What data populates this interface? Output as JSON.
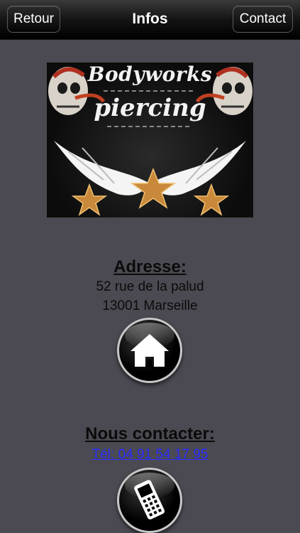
{
  "navbar": {
    "back_label": "Retour",
    "title": "Infos",
    "contact_label": "Contact"
  },
  "logo": {
    "line1": "Bodyworks",
    "line2": "piercing"
  },
  "address": {
    "title": "Adresse:",
    "line1": "52 rue de la palud",
    "line2": "13001 Marseille",
    "button_icon": "home-icon"
  },
  "contact": {
    "title": "Nous contacter:",
    "phone": "Tél: 04 91 54 17 95",
    "button_icon": "mobile-phone-icon"
  },
  "colors": {
    "background": "#4b4a52",
    "link": "#2a2aff",
    "navbar": "#000000"
  }
}
